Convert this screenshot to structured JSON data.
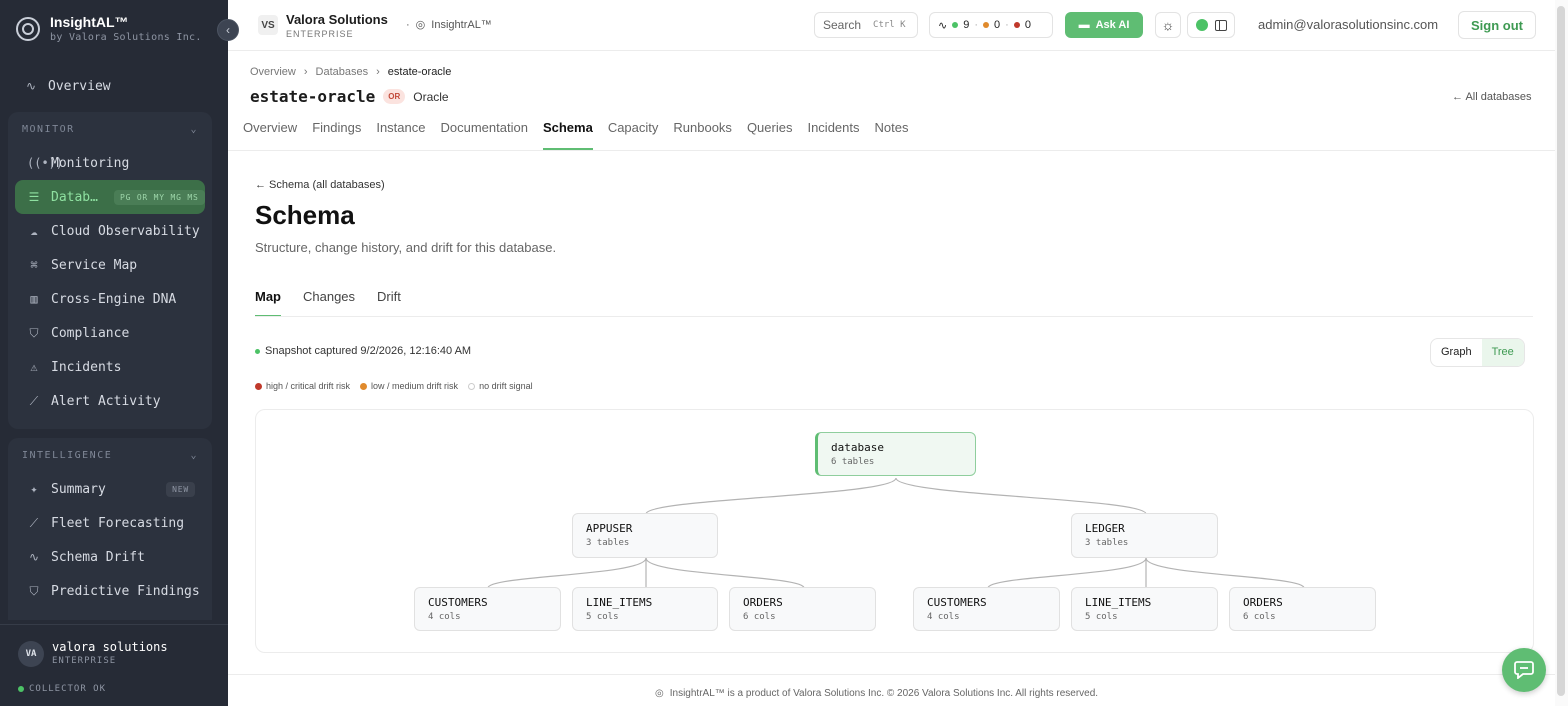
{
  "brand": {
    "name": "InsightAL™",
    "subtitle": "by Valora Solutions Inc."
  },
  "sidebar": {
    "overview": "Overview",
    "monitor": {
      "header": "MONITOR",
      "items": [
        {
          "label": "Monitoring",
          "icon": "broadcast-icon"
        },
        {
          "label": "Datab…",
          "icon": "database-icon",
          "tags": "PG OR MY MG MS",
          "active": true
        },
        {
          "label": "Cloud Observability",
          "icon": "cloud-icon"
        },
        {
          "label": "Service Map",
          "icon": "network-icon"
        },
        {
          "label": "Cross-Engine DNA",
          "icon": "bar-chart-icon"
        },
        {
          "label": "Compliance",
          "icon": "shield-icon"
        },
        {
          "label": "Incidents",
          "icon": "warning-icon"
        },
        {
          "label": "Alert Activity",
          "icon": "line-chart-icon"
        }
      ]
    },
    "intelligence": {
      "header": "INTELLIGENCE",
      "items": [
        {
          "label": "Summary",
          "icon": "sparkle-icon",
          "badge": "NEW"
        },
        {
          "label": "Fleet Forecasting",
          "icon": "trend-icon"
        },
        {
          "label": "Schema Drift",
          "icon": "pulse-icon"
        },
        {
          "label": "Predictive Findings",
          "icon": "shield-icon"
        }
      ]
    },
    "user": {
      "initials": "VA",
      "name": "valora solutions",
      "tier": "ENTERPRISE"
    },
    "collector": "COLLECTOR OK"
  },
  "topbar": {
    "org_initials": "VS",
    "org_name": "Valora Solutions",
    "org_tier": "ENTERPRISE",
    "product": "InsightrAL™",
    "search_label": "Search",
    "search_shortcut": "Ctrl K",
    "status_green": "9",
    "status_orange": "0",
    "status_red": "0",
    "ask_ai": "Ask AI",
    "email": "admin@valorasolutionsinc.com",
    "signout": "Sign out"
  },
  "breadcrumb": {
    "items": [
      "Overview",
      "Databases"
    ],
    "current": "estate-oracle"
  },
  "database": {
    "name": "estate-oracle",
    "engine_badge": "OR",
    "engine": "Oracle",
    "all_link": "← All databases"
  },
  "db_tabs": [
    "Overview",
    "Findings",
    "Instance",
    "Documentation",
    "Schema",
    "Capacity",
    "Runbooks",
    "Queries",
    "Incidents",
    "Notes"
  ],
  "db_tabs_active": "Schema",
  "schema": {
    "back_link": "← Schema (all databases)",
    "title": "Schema",
    "description": "Structure, change history, and drift for this database.",
    "tabs": [
      "Map",
      "Changes",
      "Drift"
    ],
    "active_tab": "Map",
    "snapshot": "Snapshot captured 9/2/2026, 12:16:40 AM",
    "view_options": [
      "Graph",
      "Tree"
    ],
    "view_active": "Tree",
    "legend": [
      {
        "label": "high / critical drift risk",
        "color": "#c0392b"
      },
      {
        "label": "low / medium drift risk",
        "color": "#e08a2c"
      },
      {
        "label": "no drift signal",
        "color": "#ffffff"
      }
    ]
  },
  "tree": {
    "root": {
      "name": "database",
      "sub": "6 tables"
    },
    "schemas": [
      {
        "name": "APPUSER",
        "sub": "3 tables",
        "tables": [
          {
            "name": "CUSTOMERS",
            "sub": "4 cols"
          },
          {
            "name": "LINE_ITEMS",
            "sub": "5 cols"
          },
          {
            "name": "ORDERS",
            "sub": "6 cols"
          }
        ]
      },
      {
        "name": "LEDGER",
        "sub": "3 tables",
        "tables": [
          {
            "name": "CUSTOMERS",
            "sub": "4 cols"
          },
          {
            "name": "LINE_ITEMS",
            "sub": "5 cols"
          },
          {
            "name": "ORDERS",
            "sub": "6 cols"
          }
        ]
      }
    ]
  },
  "footer": "InsightrAL™ is a product of Valora Solutions Inc. © 2026 Valora Solutions Inc. All rights reserved.",
  "colors": {
    "accent": "#5fbd73",
    "sidebar_bg": "#262b36",
    "active_nav": "#3c6f48"
  }
}
